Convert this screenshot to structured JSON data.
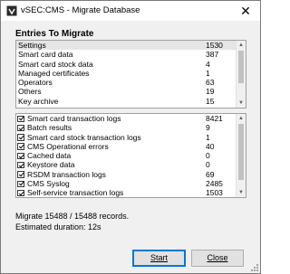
{
  "window": {
    "title": "vSEC:CMS - Migrate Database",
    "close_glyph": "✕",
    "icon": "vsec-cms-app-icon"
  },
  "heading": "Entries To Migrate",
  "summary_table": {
    "rows": [
      {
        "label": "Settings",
        "count": "1530"
      },
      {
        "label": "Smart card data",
        "count": "387"
      },
      {
        "label": "Smart card stock data",
        "count": "4"
      },
      {
        "label": "Managed certificates",
        "count": "1"
      },
      {
        "label": "Operators",
        "count": "63"
      },
      {
        "label": "Others",
        "count": "19"
      },
      {
        "label": "Key archive",
        "count": "15"
      },
      {
        "label": "RSDM data",
        "count": "15"
      }
    ]
  },
  "log_table": {
    "rows": [
      {
        "label": "Smart card transaction logs",
        "count": "8421",
        "checked": true
      },
      {
        "label": "Batch results",
        "count": "9",
        "checked": true
      },
      {
        "label": "Smart card stock transaction logs",
        "count": "1",
        "checked": true
      },
      {
        "label": "CMS Operational errors",
        "count": "40",
        "checked": true
      },
      {
        "label": "Cached data",
        "count": "0",
        "checked": true
      },
      {
        "label": "Keystore data",
        "count": "0",
        "checked": true
      },
      {
        "label": "RSDM transaction logs",
        "count": "69",
        "checked": true
      },
      {
        "label": "CMS Syslog",
        "count": "2485",
        "checked": true
      },
      {
        "label": "Self-service transaction logs",
        "count": "1503",
        "checked": true
      }
    ]
  },
  "status": {
    "progress": "Migrate 15488 / 15488 records.",
    "duration": "Estimated duration: 12s"
  },
  "buttons": {
    "start_label": "Start",
    "close_label": "Close"
  },
  "colors": {
    "default_button_border": "#0078d7",
    "window_background": "#f0f0f0"
  }
}
